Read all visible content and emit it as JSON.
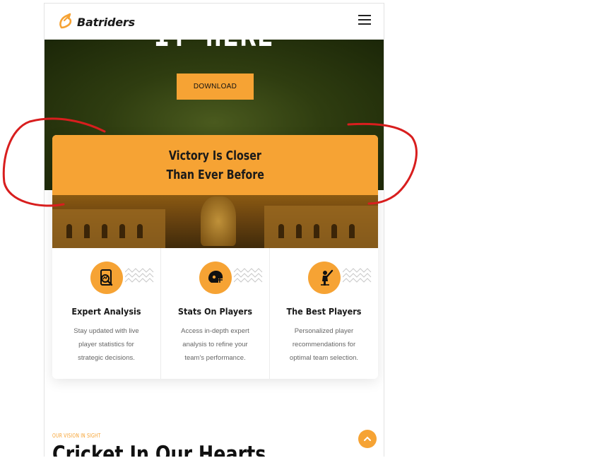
{
  "brand": {
    "name": "Batriders",
    "logo_icon": "bat-logo-icon"
  },
  "nav": {
    "menu_icon": "hamburger-icon"
  },
  "hero": {
    "title": "IT HERE",
    "download_label": "DOWNLOAD"
  },
  "banner": {
    "line1": "Victory Is Closer",
    "line2": "Than Ever Before"
  },
  "features": [
    {
      "icon": "analysis-icon",
      "title": "Expert Analysis",
      "desc": "Stay updated with live player statistics for strategic decisions."
    },
    {
      "icon": "helmet-icon",
      "title": "Stats On Players",
      "desc": "Access in-depth expert analysis to refine your team's performance."
    },
    {
      "icon": "batsman-icon",
      "title": "The Best Players",
      "desc": "Personalized player recommendations for optimal team selection."
    }
  ],
  "vision": {
    "label": "OUR VISION IN SIGHT",
    "title": "Cricket In Our Hearts"
  },
  "colors": {
    "accent": "#f6a334",
    "annotation": "#d81e1e",
    "hero_green": "#2f3d10"
  }
}
